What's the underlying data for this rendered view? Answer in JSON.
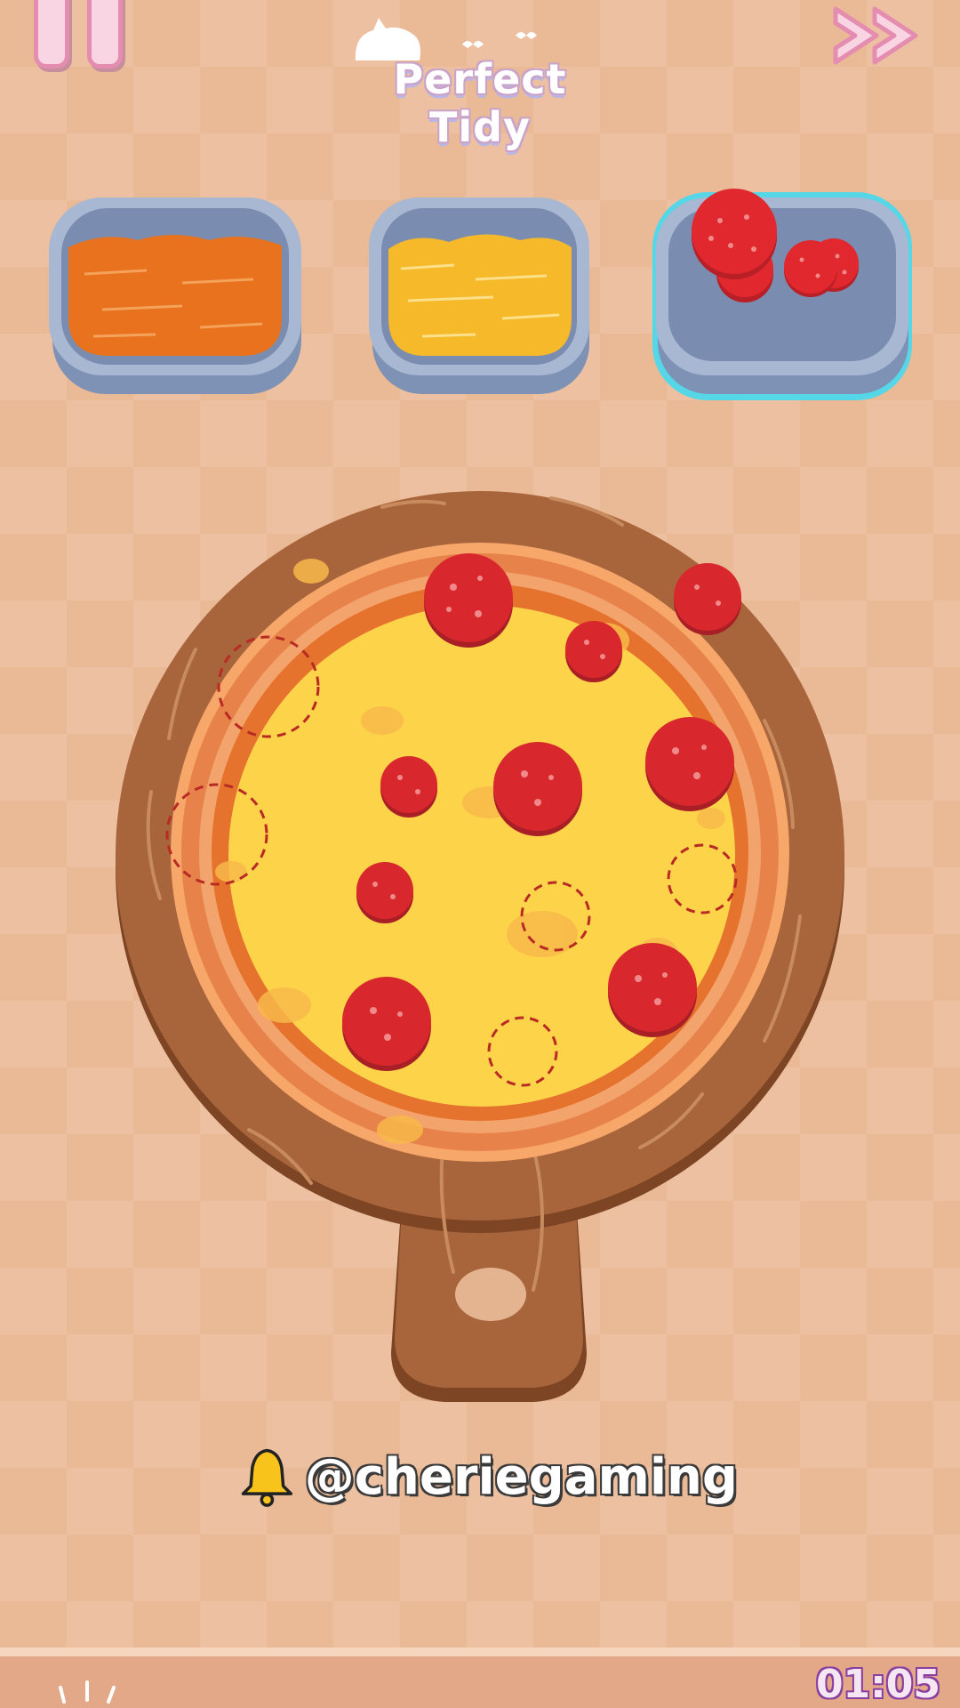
{
  "header": {
    "logo_text": "Perfect Tidy",
    "pause_icon": "pause-icon",
    "skip_icon": "fast-forward-icon"
  },
  "ingredients": [
    {
      "name": "sauce",
      "color": "#e8721e",
      "selected": false
    },
    {
      "name": "cheese",
      "color": "#f6b92a",
      "selected": false
    },
    {
      "name": "pepperoni",
      "color": "#e0282e",
      "selected": true
    }
  ],
  "pizza": {
    "cheese_color": "#fdd34a",
    "pepperoni_color": "#d8282d"
  },
  "watermark": {
    "icon": "bell-icon",
    "handle": "@cheriegaming"
  },
  "timer": "01:05"
}
